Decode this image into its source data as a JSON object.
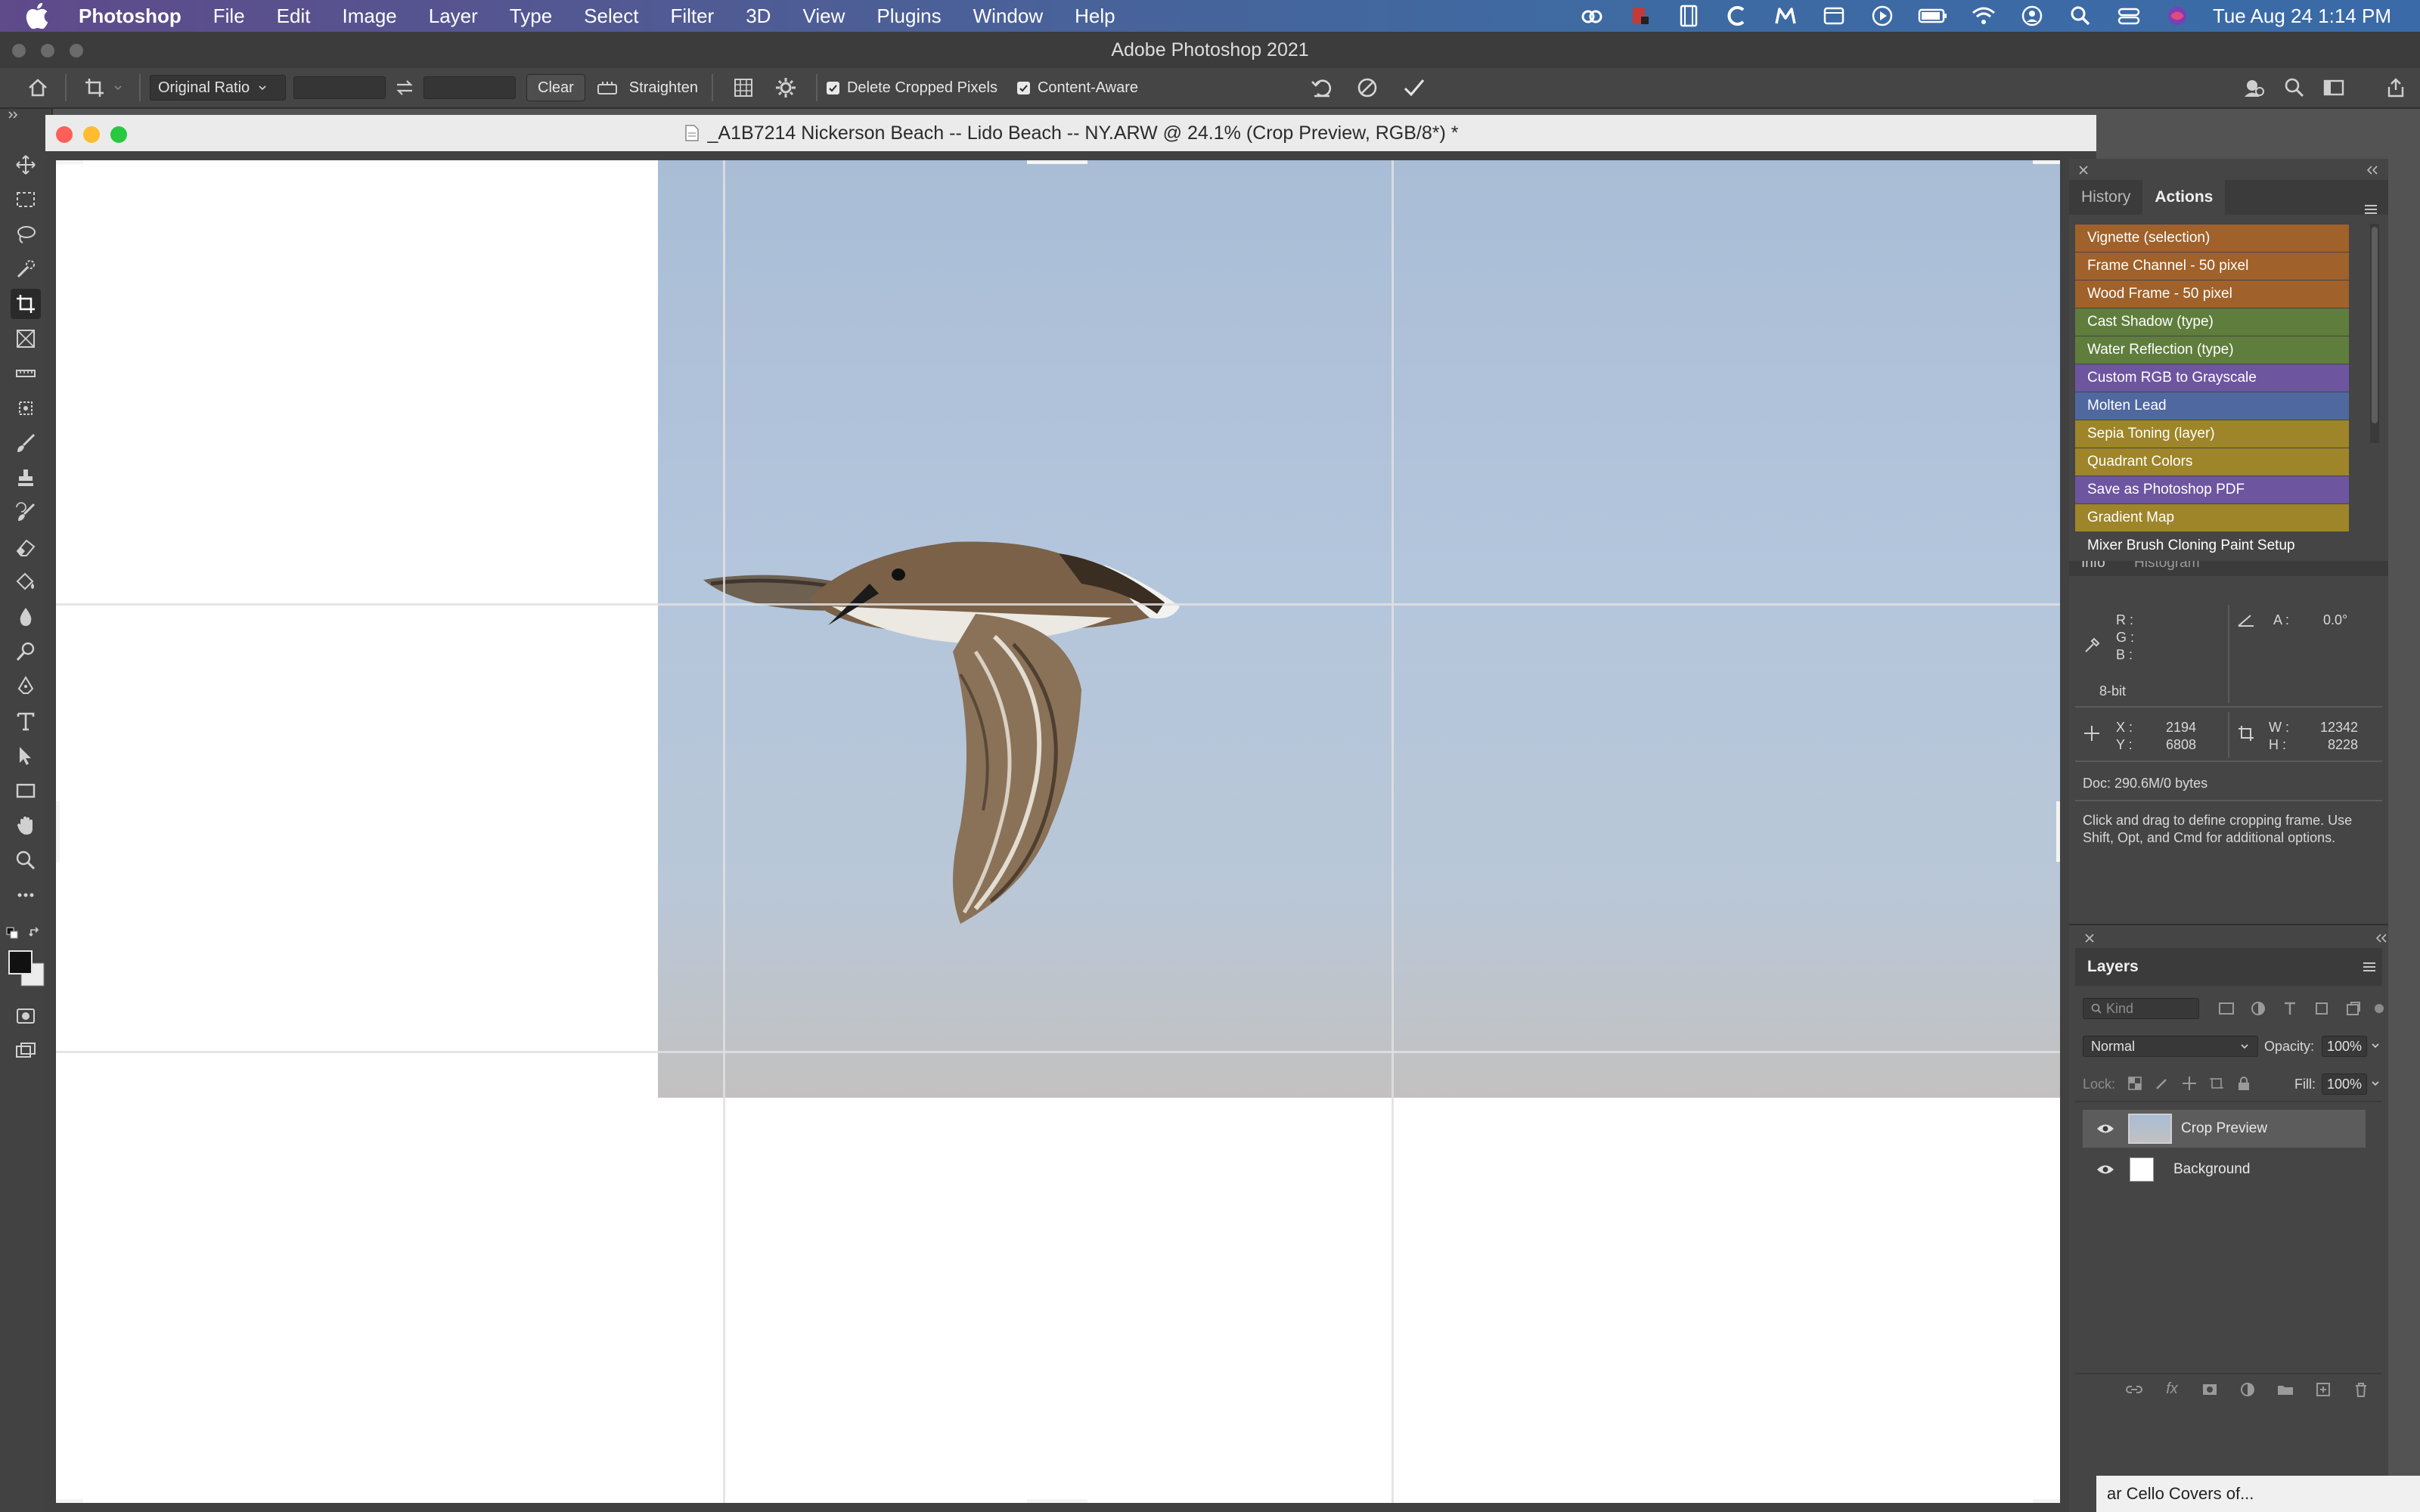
{
  "menubar": {
    "app_name": "Photoshop",
    "items": [
      "File",
      "Edit",
      "Image",
      "Layer",
      "Type",
      "Select",
      "Filter",
      "3D",
      "View",
      "Plugins",
      "Window",
      "Help"
    ],
    "clock": "Tue Aug 24  1:14 PM"
  },
  "app_title": "Adobe Photoshop 2021",
  "options_bar": {
    "ratio_select": "Original Ratio",
    "clear_label": "Clear",
    "straighten_label": "Straighten",
    "delete_cropped_label": "Delete Cropped Pixels",
    "delete_cropped_checked": true,
    "content_aware_label": "Content-Aware",
    "content_aware_checked": true
  },
  "document": {
    "title": "_A1B7214  Nickerson Beach -- Lido Beach -- NY.ARW @ 24.1% (Crop Preview, RGB/8*) *"
  },
  "actions_panel": {
    "tabs": [
      "History",
      "Actions"
    ],
    "active_tab": "Actions",
    "items": [
      {
        "label": "Vignette (selection)",
        "color": "#a0612a"
      },
      {
        "label": "Frame Channel - 50 pixel",
        "color": "#a0612a"
      },
      {
        "label": "Wood Frame - 50 pixel",
        "color": "#a0612a"
      },
      {
        "label": "Cast Shadow (type)",
        "color": "#5f7d3c"
      },
      {
        "label": "Water Reflection (type)",
        "color": "#5f7d3c"
      },
      {
        "label": "Custom RGB to Grayscale",
        "color": "#6d55a0"
      },
      {
        "label": "Molten Lead",
        "color": "#4f68a0"
      },
      {
        "label": "Sepia Toning (layer)",
        "color": "#9e8529"
      },
      {
        "label": "Quadrant Colors",
        "color": "#9e8529"
      },
      {
        "label": "Save as Photoshop PDF",
        "color": "#6d55a0"
      },
      {
        "label": "Gradient Map",
        "color": "#9e8529"
      },
      {
        "label": "Mixer Brush Cloning Paint Setup",
        "color": "#454545"
      }
    ]
  },
  "info_panel": {
    "tabs": [
      "Info",
      "Histogram"
    ],
    "r_label": "R :",
    "g_label": "G :",
    "b_label": "B :",
    "angle_label": "A :",
    "angle_value": "0.0°",
    "bit_depth": "8-bit",
    "x_label": "X :",
    "x_value": "2194",
    "y_label": "Y :",
    "y_value": "6808",
    "w_label": "W :",
    "w_value": "12342",
    "h_label": "H :",
    "h_value": "8228",
    "doc_size": "Doc: 290.6M/0 bytes",
    "help_text": "Click and drag to define cropping frame. Use Shift, Opt, and Cmd for additional options."
  },
  "layers_panel": {
    "title": "Layers",
    "filter_placeholder": "Kind",
    "blend_mode": "Normal",
    "opacity_label": "Opacity:",
    "opacity_value": "100%",
    "lock_label": "Lock:",
    "fill_label": "Fill:",
    "fill_value": "100%",
    "layers": [
      {
        "name": "Crop Preview",
        "selected": true
      },
      {
        "name": "Background",
        "selected": false
      }
    ]
  },
  "background_window_text": "ar Cello Covers of..."
}
